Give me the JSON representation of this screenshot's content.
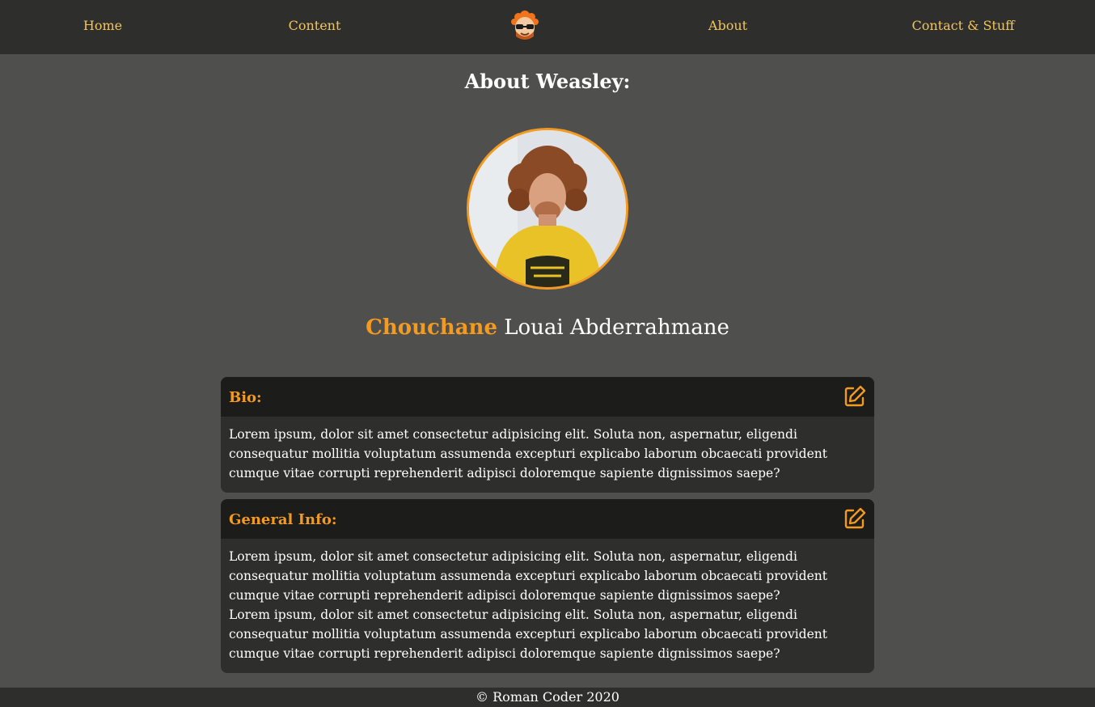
{
  "nav": {
    "home": "Home",
    "content": "Content",
    "about": "About",
    "contact": "Contact & Stuff"
  },
  "page": {
    "title": "About Weasley:"
  },
  "profile": {
    "first": "Chouchane",
    "rest": "Louai Abderrahmane"
  },
  "cards": {
    "bio": {
      "title": "Bio:",
      "text": "Lorem ipsum, dolor sit amet consectetur adipisicing elit. Soluta non, aspernatur, eligendi consequatur mollitia voluptatum assumenda excepturi explicabo laborum obcaecati provident cumque vitae corrupti reprehenderit adipisci doloremque sapiente dignissimos saepe?"
    },
    "general": {
      "title": "General Info:",
      "para1": "Lorem ipsum, dolor sit amet consectetur adipisicing elit. Soluta non, aspernatur, eligendi consequatur mollitia voluptatum assumenda excepturi explicabo laborum obcaecati provident cumque vitae corrupti reprehenderit adipisci doloremque sapiente dignissimos saepe?",
      "para2": "Lorem ipsum, dolor sit amet consectetur adipisicing elit. Soluta non, aspernatur, eligendi consequatur mollitia voluptatum assumenda excepturi explicabo laborum obcaecati provident cumque vitae corrupti reprehenderit adipisci doloremque sapiente dignissimos saepe?"
    }
  },
  "footer": {
    "text": "© Roman Coder 2020"
  },
  "icons": {
    "logo": "cartoon-face-logo-icon",
    "edit": "edit-icon"
  },
  "colors": {
    "accent": "#f39a21",
    "nav_link": "#f3c45a",
    "background": "#4f4f4d",
    "navbar": "#2e2e2d",
    "card_header": "#1c1c1b"
  }
}
